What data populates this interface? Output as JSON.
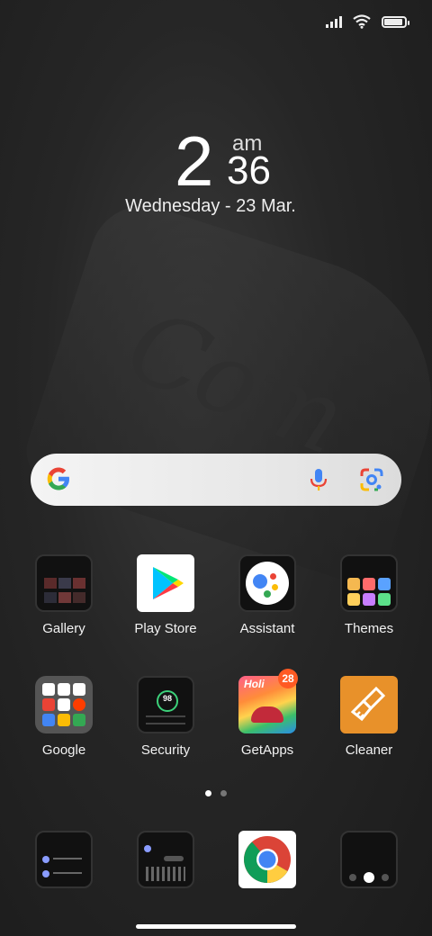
{
  "status_bar": {
    "signal_icon": "cellular-signal-icon",
    "wifi_icon": "wifi-icon",
    "battery_icon": "battery-icon",
    "battery_level": 0.9
  },
  "clock": {
    "hour": "2",
    "ampm": "am",
    "minute": "36",
    "date": "Wednesday - 23 Mar."
  },
  "search_bar": {
    "logo_icon": "google-g-icon",
    "mic_icon": "microphone-icon",
    "lens_icon": "google-lens-icon"
  },
  "apps_row1": [
    {
      "label": "Gallery"
    },
    {
      "label": "Play Store"
    },
    {
      "label": "Assistant"
    },
    {
      "label": "Themes"
    }
  ],
  "apps_row2": [
    {
      "label": "Google"
    },
    {
      "label": "Security",
      "score": "98"
    },
    {
      "label": "GetApps",
      "badge": "28",
      "banner": "Holi"
    },
    {
      "label": "Cleaner"
    }
  ],
  "page_indicator": {
    "pages": 2,
    "current": 1
  },
  "dock": [
    {
      "icon": "contacts-phone-icon"
    },
    {
      "icon": "messages-icon"
    },
    {
      "icon": "chrome-icon"
    },
    {
      "icon": "camera-icon"
    }
  ],
  "colors": {
    "badge": "#ff5a23",
    "cleaner": "#e8912a"
  }
}
